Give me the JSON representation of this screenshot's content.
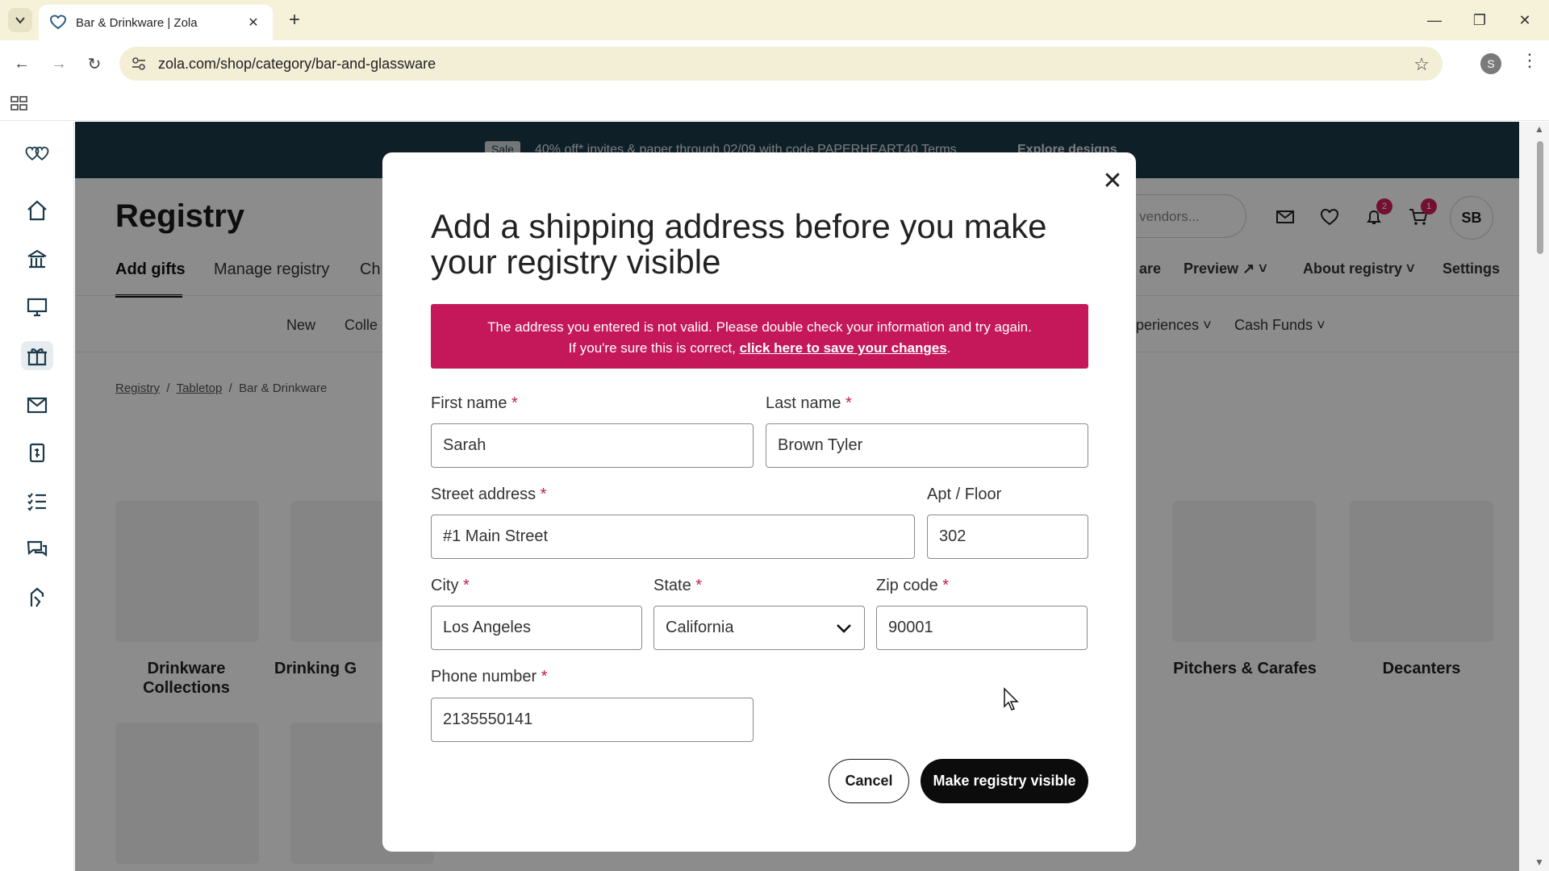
{
  "browser": {
    "tab_title": "Bar & Drinkware | Zola",
    "url": "zola.com/shop/category/bar-and-glassware",
    "profile_initial": "S"
  },
  "banner": {
    "sale_tag": "Sale",
    "message": "40% off* invites & paper through 02/09 with code PAPERHEART40 Terms",
    "cta": "Explore designs"
  },
  "header": {
    "title": "Registry",
    "search_placeholder": "les, vendors...",
    "notifications_count": "2",
    "cart_count": "1",
    "avatar_initials": "SB"
  },
  "subnav": {
    "items": [
      "Add gifts",
      "Manage registry",
      "Ch"
    ],
    "right_items": [
      "are",
      "Preview",
      "About registry",
      "Settings"
    ]
  },
  "category_nav": {
    "items": [
      "New",
      "Colle",
      "periences",
      "Cash Funds"
    ]
  },
  "breadcrumb": [
    "Registry",
    "Tabletop",
    "Bar & Drinkware"
  ],
  "tiles": {
    "labels": [
      "Drinkware Collections",
      "Drinking G",
      "Pitchers & Carafes",
      "Decanters"
    ]
  },
  "modal": {
    "title": "Add a shipping address before you make your registry visible",
    "alert_line1": "The address you entered is not valid. Please double check your information and try again.",
    "alert_line2_prefix": "If you're sure this is correct, ",
    "alert_link": "click here to save your changes",
    "alert_line2_suffix": ".",
    "fields": {
      "first_name": {
        "label": "First name",
        "value": "Sarah"
      },
      "last_name": {
        "label": "Last name",
        "value": "Brown Tyler"
      },
      "street": {
        "label": "Street address",
        "value": "#1 Main Street"
      },
      "apt": {
        "label": "Apt / Floor",
        "value": "302"
      },
      "city": {
        "label": "City",
        "value": "Los Angeles"
      },
      "state": {
        "label": "State",
        "value": "California"
      },
      "zip": {
        "label": "Zip code",
        "value": "90001"
      },
      "phone": {
        "label": "Phone number",
        "value": "2135550141"
      }
    },
    "required_marker": "*",
    "cancel_label": "Cancel",
    "submit_label": "Make registry visible"
  },
  "colors": {
    "alert_bg": "#c4185a",
    "banner_bg": "#1c3a4a",
    "primary_button": "#0c0c0c"
  }
}
